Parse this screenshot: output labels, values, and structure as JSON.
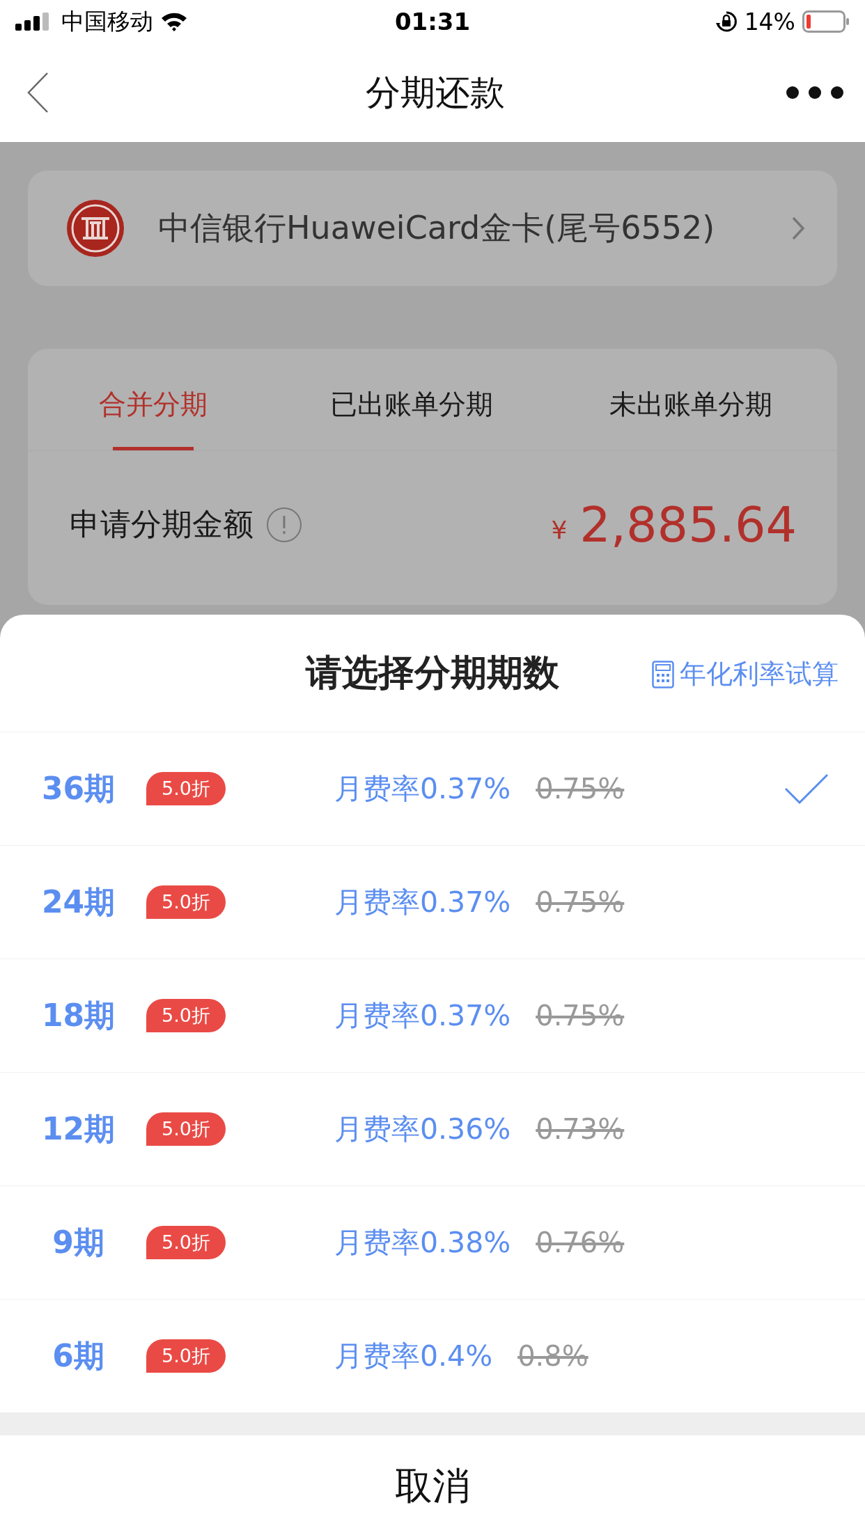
{
  "status_bar": {
    "carrier": "中国移动",
    "time": "01:31",
    "battery": "14%"
  },
  "nav": {
    "title": "分期还款"
  },
  "card": {
    "name": "中信银行HuaweiCard金卡(尾号6552)"
  },
  "tabs": [
    {
      "label": "合并分期",
      "selected": true
    },
    {
      "label": "已出账单分期",
      "selected": false
    },
    {
      "label": "未出账单分期",
      "selected": false
    }
  ],
  "amount": {
    "label": "申请分期金额",
    "currency": "¥",
    "value": "2,885.64"
  },
  "sheet": {
    "title": "请选择分期期数",
    "calculator": "年化利率试算",
    "options": [
      {
        "term": "36期",
        "badge": "5.0折",
        "rate": "月费率0.37%",
        "original": "0.75%",
        "selected": true
      },
      {
        "term": "24期",
        "badge": "5.0折",
        "rate": "月费率0.37%",
        "original": "0.75%",
        "selected": false
      },
      {
        "term": "18期",
        "badge": "5.0折",
        "rate": "月费率0.37%",
        "original": "0.75%",
        "selected": false
      },
      {
        "term": "12期",
        "badge": "5.0折",
        "rate": "月费率0.36%",
        "original": "0.73%",
        "selected": false
      },
      {
        "term": "9期",
        "badge": "5.0折",
        "rate": "月费率0.38%",
        "original": "0.76%",
        "selected": false
      },
      {
        "term": "6期",
        "badge": "5.0折",
        "rate": "月费率0.4%",
        "original": "0.8%",
        "selected": false
      }
    ],
    "cancel": "取消"
  }
}
